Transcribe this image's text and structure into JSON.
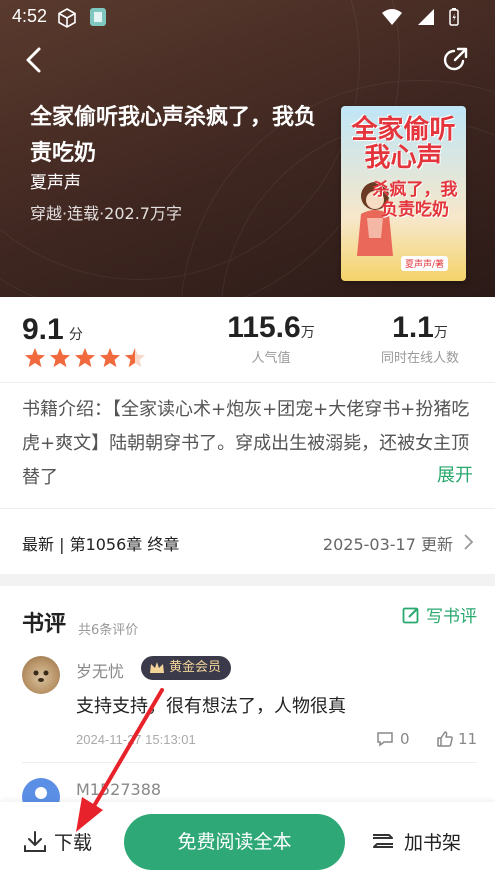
{
  "status": {
    "time": "4:52"
  },
  "book": {
    "title": "全家偷听我心声杀疯了，我负责吃奶",
    "author": "夏声声",
    "meta": "穿越·连载·202.7万字",
    "cover": {
      "title": "全家偷听我心声",
      "subtitle": "杀疯了，我负责吃奶",
      "author_tag": "夏声声/著"
    }
  },
  "stats": {
    "score": "9.1",
    "score_unit": "分",
    "stars": 4.5,
    "popularity": {
      "value": "115.6",
      "unit": "万",
      "label": "人气值"
    },
    "online": {
      "value": "1.1",
      "unit": "万",
      "label": "同时在线人数"
    }
  },
  "intro": {
    "text": "书籍介绍：【全家读心术+炮灰+团宠+大佬穿书+扮猪吃虎+爽文】陆朝朝穿书了。穿成出生被溺毙，还被女主顶替了",
    "expand": "展开"
  },
  "latest": {
    "chapter": "最新 | 第1056章 终章",
    "date": "2025-03-17 更新"
  },
  "reviews": {
    "title": "书评",
    "count": "共6条评价",
    "write": "写书评",
    "items": [
      {
        "user": "岁无忧",
        "badge": "黄金会员",
        "text": "支持支持，很有想法了，人物很真",
        "date": "2024-11-27 15:13:01",
        "comments": "0",
        "likes": "11"
      },
      {
        "user": "M1527388"
      }
    ]
  },
  "bottom": {
    "download": "下载",
    "read": "免费阅读全本",
    "shelf": "加书架"
  },
  "colors": {
    "accent": "#2fa877",
    "header_bg": "#3e2620",
    "star": "#f06a3e",
    "annotation": "#e8222a"
  }
}
